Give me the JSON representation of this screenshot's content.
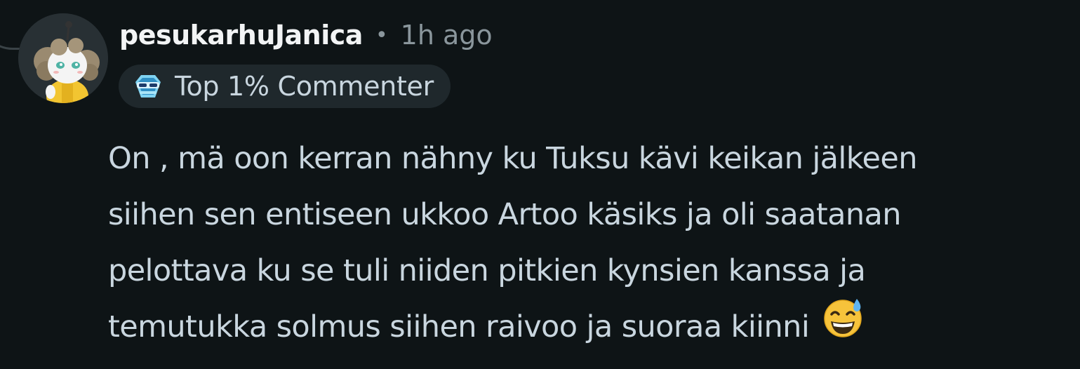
{
  "comment": {
    "author": "pesukarhuJanica",
    "separator": "•",
    "time_ago": "1h ago",
    "badge": {
      "icon": "top-commenter-badge-icon",
      "label": "Top 1% Commenter"
    },
    "avatar_icon": "snoo-avatar-icon",
    "body_lines": [
      "On , mä oon kerran nähny ku Tuksu kävi keikan jälkeen",
      "siihen sen entiseen ukkoo Artoo käsiks ja oli saatanan",
      "pelottava ku se tuli niiden pitkien kynsien kanssa ja",
      "temutukka solmus siihen raivoo ja suoraa kiinni"
    ],
    "trailing_emoji": "grinning-face-with-sweat-emoji"
  },
  "colors": {
    "background": "#0e1416",
    "username": "#f2f4f5",
    "meta": "#8a969c",
    "text": "#c9d6df",
    "badge_bg": "#1f282c"
  }
}
